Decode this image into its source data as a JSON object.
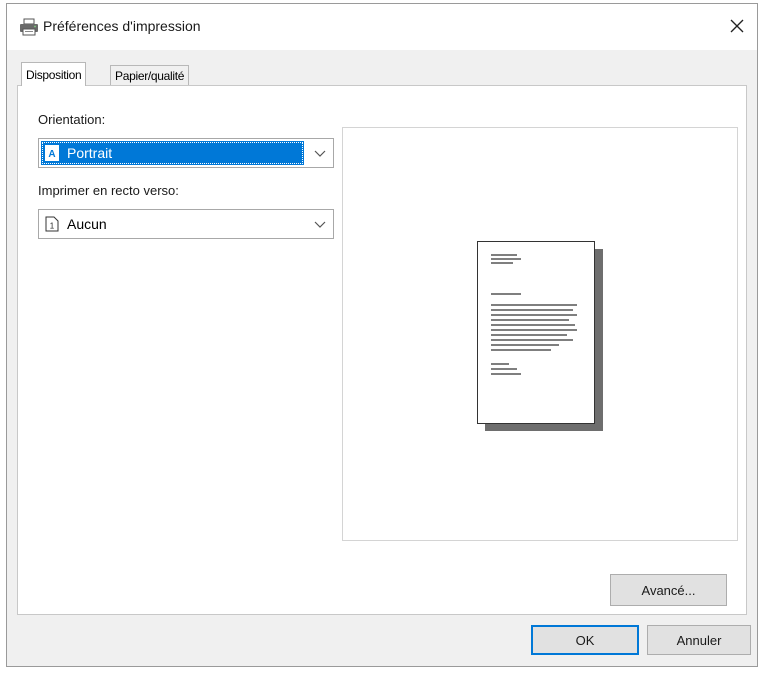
{
  "window": {
    "title": "Préférences d'impression",
    "icons": {
      "app": "printer-icon",
      "close": "close-icon"
    }
  },
  "tabs": [
    {
      "label": "Disposition",
      "active": true
    },
    {
      "label": "Papier/qualité",
      "active": false
    }
  ],
  "layout_tab": {
    "orientation_label": "Orientation:",
    "orientation_value": "Portrait",
    "orientation_icon": "portrait-page-icon",
    "duplex_label": "Imprimer en recto verso:",
    "duplex_value": "Aucun",
    "duplex_icon": "single-page-icon",
    "preview_icon": "page-preview-icon",
    "advanced_button": "Avancé..."
  },
  "footer": {
    "ok_button": "OK",
    "cancel_button": "Annuler"
  },
  "colors": {
    "accent": "#0078d7",
    "dialog_bg": "#f0f0f0",
    "panel_bg": "#ffffff"
  }
}
